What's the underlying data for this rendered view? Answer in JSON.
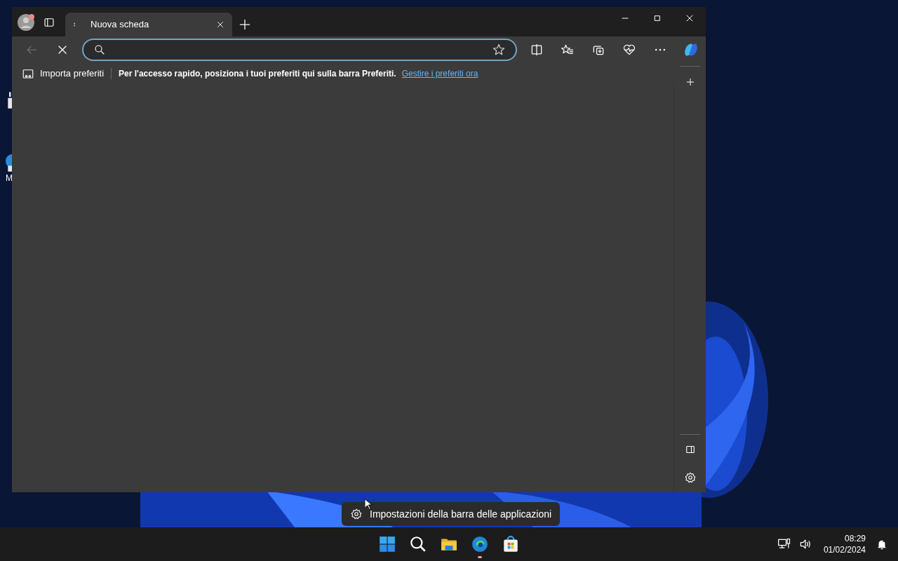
{
  "desktop": {
    "icons": [
      {
        "kind": "document"
      },
      {
        "kind": "edge",
        "label": "M"
      }
    ]
  },
  "browser": {
    "tabs": [
      {
        "title": "Nuova scheda",
        "selected": true
      }
    ],
    "toolbar": {
      "back_disabled": true,
      "loading": true
    },
    "favorites_bar": {
      "import_label": "Importa preferiti",
      "message": "Per l'accesso rapido, posiziona i tuoi preferiti qui sulla barra Preferiti.",
      "link": "Gestire i preferiti ora"
    }
  },
  "context_menu": {
    "items": [
      "Impostazioni della barra delle applicazioni"
    ]
  },
  "taskbar": {
    "apps": [
      {
        "kind": "start",
        "running": false
      },
      {
        "kind": "search",
        "running": false
      },
      {
        "kind": "explorer",
        "running": false
      },
      {
        "kind": "edge",
        "running": true
      },
      {
        "kind": "store",
        "running": false
      }
    ],
    "time": "08:29",
    "date": "01/02/2024"
  }
}
